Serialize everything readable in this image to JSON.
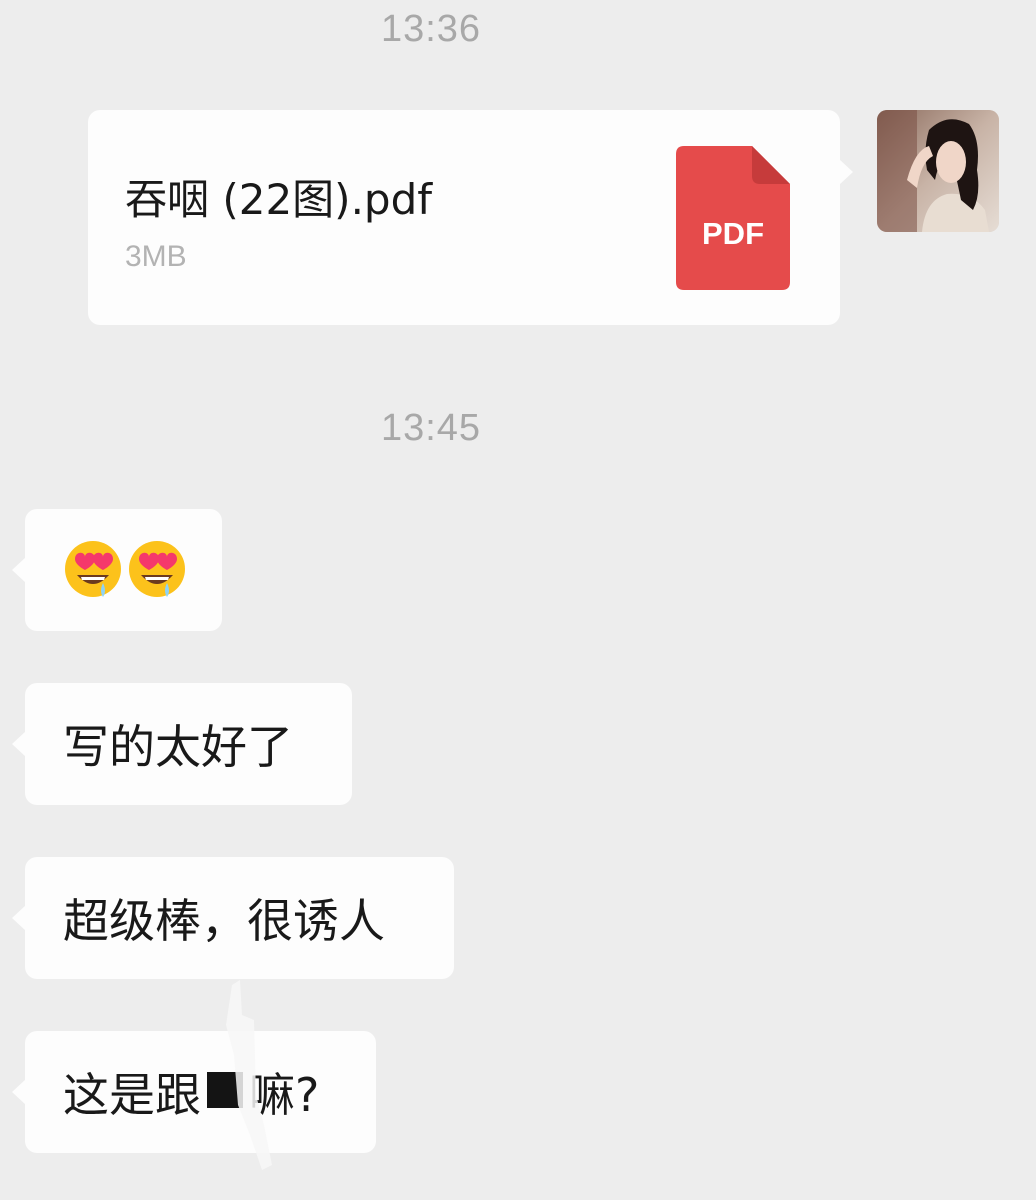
{
  "messages": {
    "time_1": "13:36",
    "file": {
      "name": "吞咽 (22图).pdf",
      "size": "3MB",
      "icon_label": "PDF",
      "icon_color": "#e54b4b"
    },
    "time_2": "13:45",
    "emoji_icons": [
      "heart-eyes-drooling-emoji",
      "heart-eyes-drooling-emoji"
    ],
    "text_1": "写的太好了",
    "text_2": "超级棒，很诱人",
    "text_3_prefix": "这是跟",
    "text_3_suffix": "嘛?"
  },
  "colors": {
    "background": "#ededed",
    "bubble": "#fdfdfd",
    "timestamp": "#a8a8a8",
    "pdf_red": "#e54b4b"
  }
}
